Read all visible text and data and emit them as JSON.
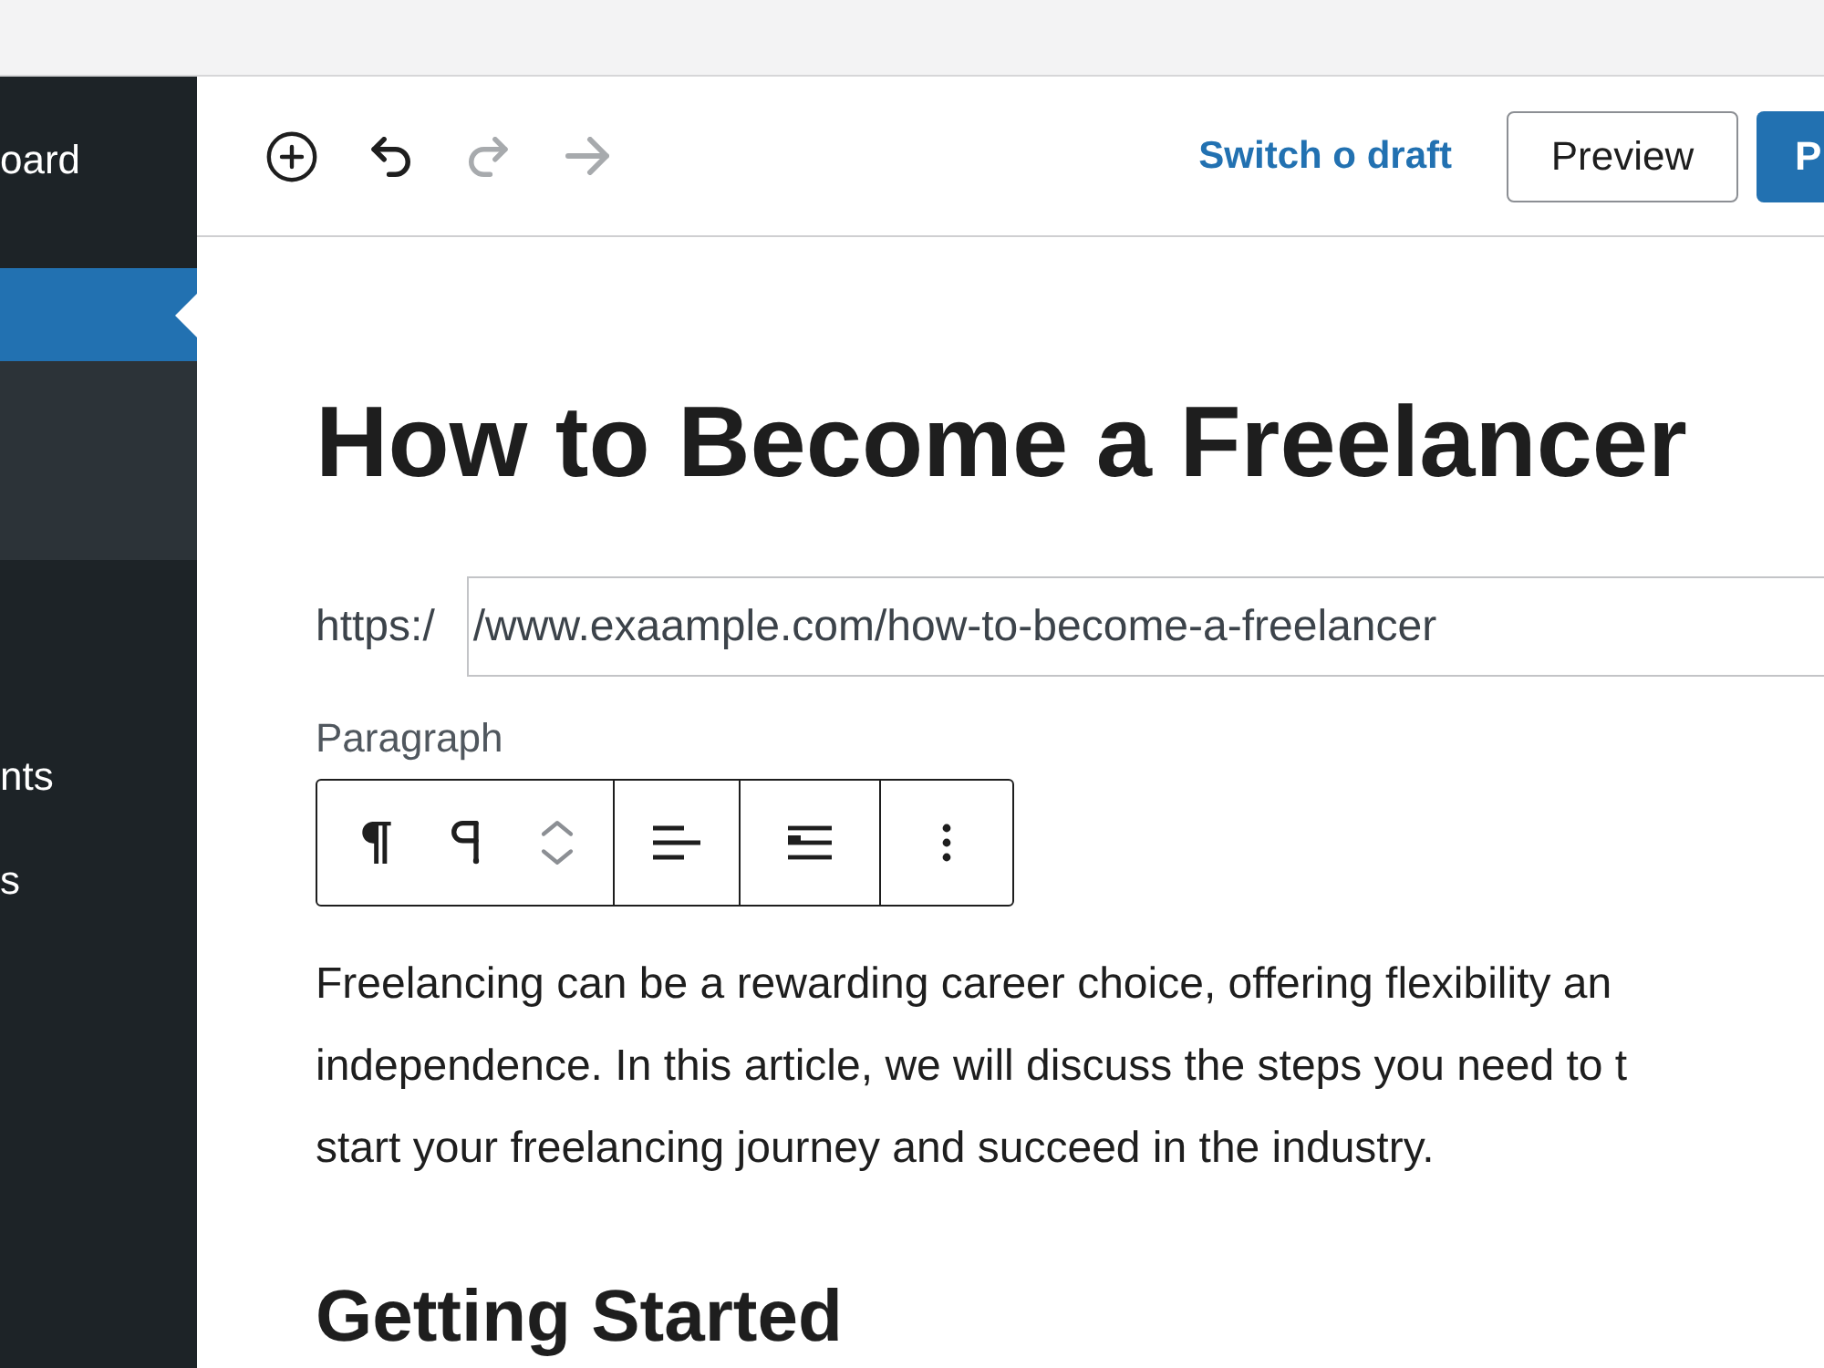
{
  "sidebar": {
    "items": [
      {
        "label": "oard",
        "selected": false
      },
      {
        "selected": true
      },
      {
        "label": "nts",
        "selected": false
      },
      {
        "label": "s",
        "selected": false
      }
    ]
  },
  "header": {
    "tools": [
      {
        "kind": "add",
        "disabled": false
      },
      {
        "kind": "undo",
        "disabled": false
      },
      {
        "kind": "redo",
        "disabled": true
      },
      {
        "kind": "next",
        "disabled": true
      }
    ],
    "switch_link": "Switch o draft",
    "preview_button": "Preview",
    "publish_button": "P"
  },
  "editor": {
    "title": "How to Become a Freelancer",
    "url": {
      "prefix": "https:/",
      "value": "/www.exaample.com/how-to-become-a-freelancer"
    },
    "block_label": "Paragraph",
    "block_toolbar": {
      "groups": [
        {
          "buttons": [
            {
              "kind": "pilcrow"
            },
            {
              "kind": "mark"
            },
            {
              "kind": "move"
            }
          ]
        },
        {
          "buttons": [
            {
              "kind": "align"
            }
          ]
        },
        {
          "buttons": [
            {
              "kind": "wide"
            }
          ]
        },
        {
          "buttons": [
            {
              "kind": "more"
            }
          ]
        }
      ]
    },
    "paragraph": {
      "lines": [
        "Freelancing can be a rewarding career choice, offering flexibility an",
        "independence. In this article, we will discuss the steps you need to t",
        "start your freelancing journey and succeed in the industry."
      ]
    },
    "heading": "Getting Started"
  }
}
